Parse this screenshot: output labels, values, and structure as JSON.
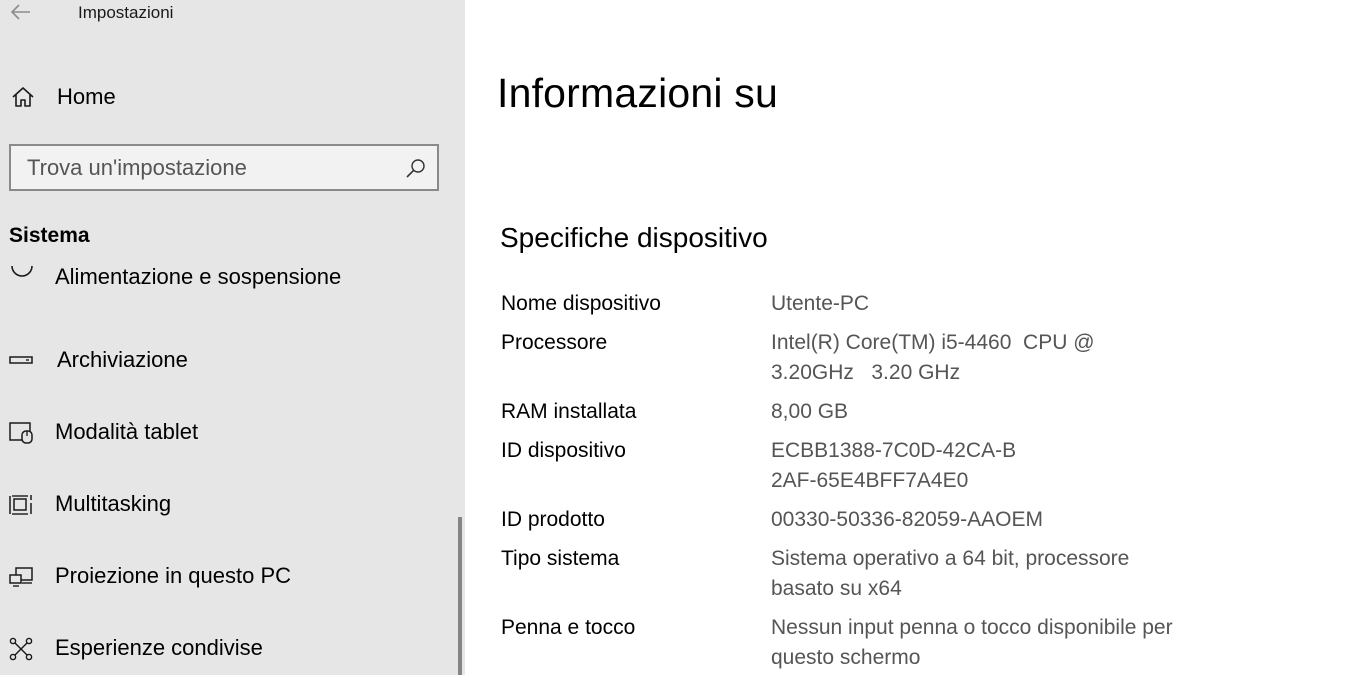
{
  "window": {
    "title": "Impostazioni"
  },
  "sidebar": {
    "home_label": "Home",
    "search": {
      "placeholder": "Trova un'impostazione",
      "value": ""
    },
    "section_title": "Sistema",
    "items": [
      {
        "label": "Alimentazione e sospensione",
        "icon": "power-icon"
      },
      {
        "label": "Archiviazione",
        "icon": "storage-icon"
      },
      {
        "label": "Modalità tablet",
        "icon": "tablet-mode-icon"
      },
      {
        "label": "Multitasking",
        "icon": "multitasking-icon"
      },
      {
        "label": "Proiezione in questo PC",
        "icon": "projecting-icon"
      },
      {
        "label": "Esperienze condivise",
        "icon": "shared-experiences-icon"
      }
    ]
  },
  "main": {
    "title": "Informazioni su",
    "specs_title": "Specifiche dispositivo",
    "specs": [
      {
        "label": "Nome dispositivo",
        "value": "Utente-PC"
      },
      {
        "label": "Processore",
        "value": "Intel(R) Core(TM) i5-4460  CPU @ 3.20GHz   3.20 GHz"
      },
      {
        "label": "RAM installata",
        "value": "8,00 GB"
      },
      {
        "label": "ID dispositivo",
        "value": "ECBB1388-7C0D-42CA-B2AF-65E4BFF7A4E0"
      },
      {
        "label": "ID prodotto",
        "value": "00330-50336-82059-AAOEM"
      },
      {
        "label": "Tipo sistema",
        "value": "Sistema operativo a 64 bit, processore basato su x64"
      },
      {
        "label": "Penna e tocco",
        "value": "Nessun input penna o tocco disponibile per questo schermo"
      }
    ]
  },
  "colors": {
    "sidebar_bg": "#e6e6e6",
    "main_bg": "#ffffff",
    "secondary_text": "#555555"
  }
}
